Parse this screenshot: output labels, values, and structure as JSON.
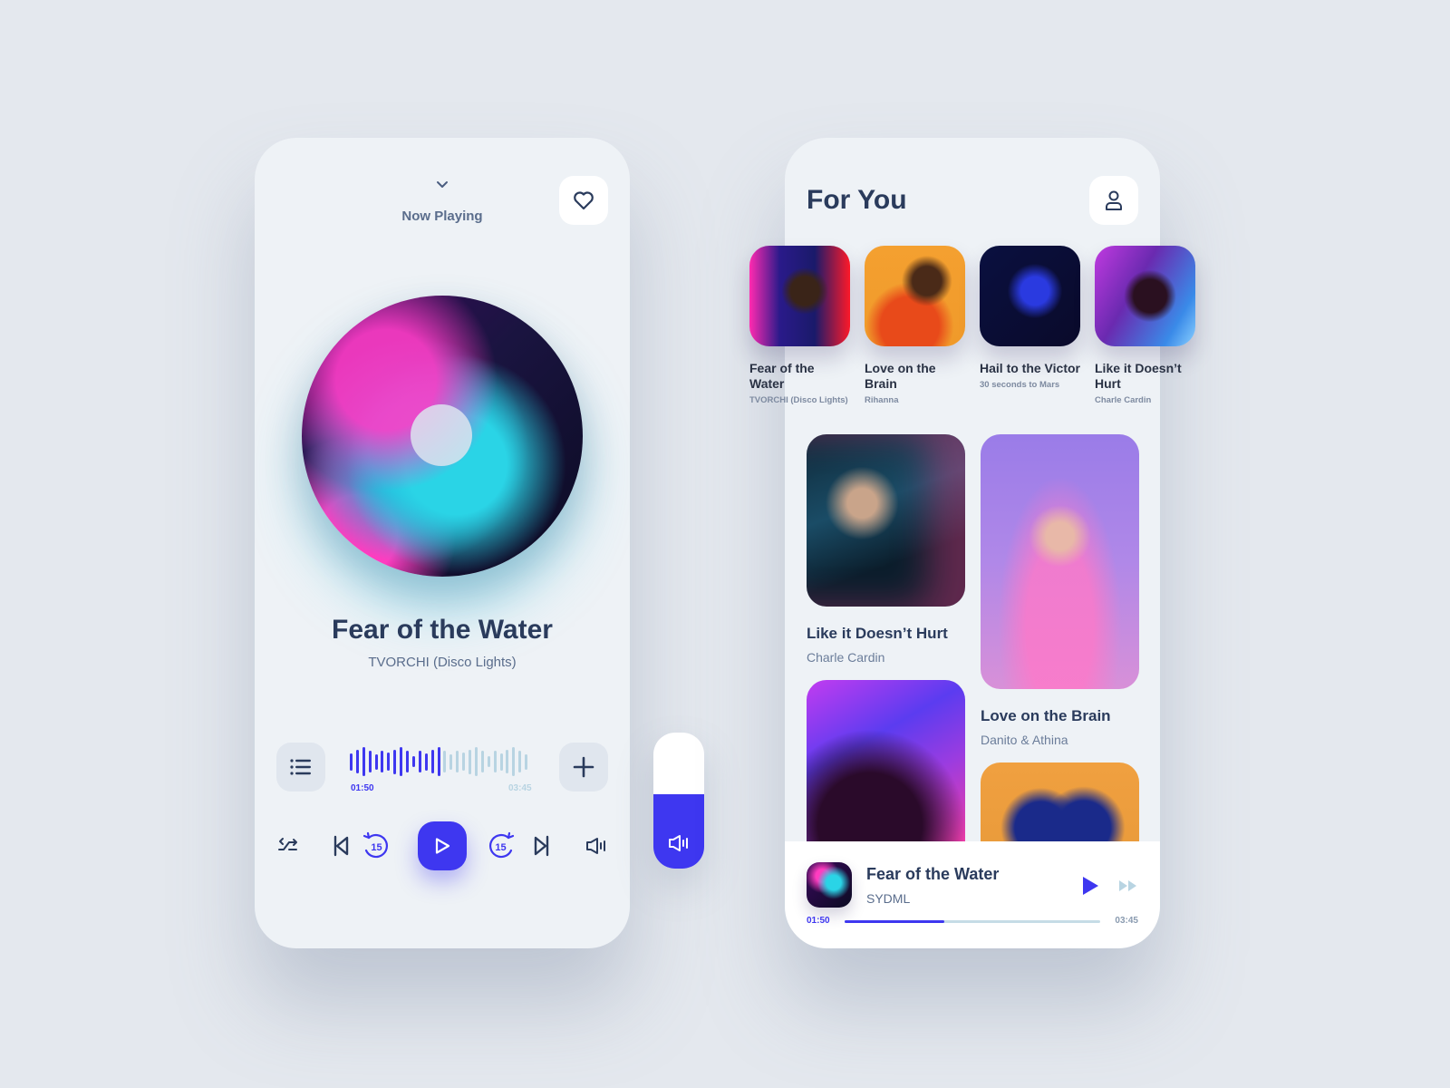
{
  "now_playing": {
    "header_title": "Now Playing",
    "song_title": "Fear of the Water",
    "artist": "TVORCHI (Disco Lights)",
    "current_time": "01:50",
    "total_time": "03:45",
    "progress": 0.49,
    "waveform_levels": [
      0.55,
      0.75,
      0.95,
      0.7,
      0.5,
      0.7,
      0.6,
      0.8,
      0.95,
      0.7,
      0.35,
      0.7,
      0.55,
      0.75,
      0.95,
      0.7,
      0.5,
      0.7,
      0.6,
      0.8,
      0.95,
      0.7,
      0.35,
      0.7,
      0.55,
      0.75,
      0.95,
      0.7,
      0.5
    ],
    "skip_back_seconds": "15",
    "skip_forward_seconds": "15",
    "icons": {
      "collapse": "chevron-down-icon",
      "favorite": "heart-icon",
      "playlist": "list-icon",
      "add": "plus-icon",
      "shuffle": "shuffle-icon",
      "previous": "skip-previous-icon",
      "rewind": "rewind-15-icon",
      "play": "play-icon",
      "forward": "forward-15-icon",
      "next": "skip-next-icon",
      "volume": "volume-icon"
    }
  },
  "volume": {
    "level": 0.55
  },
  "for_you": {
    "title": "For You",
    "featured": [
      {
        "title": "Fear of the Water",
        "artist": "TVORCHI (Disco Lights)"
      },
      {
        "title": "Love on the Brain",
        "artist": "Rihanna"
      },
      {
        "title": "Hail to the Victor",
        "artist": "30 seconds to Mars"
      },
      {
        "title": "Like it Doesn’t Hurt",
        "artist": "Charle Cardin"
      }
    ],
    "grid": [
      {
        "title": "Like it Doesn’t Hurt",
        "artist": "Charle Cardin"
      },
      {
        "title": "Love on the Brain",
        "artist": "Danito & Athina"
      }
    ],
    "mini_player": {
      "title": "Fear of the Water",
      "artist": "SYDML",
      "current_time": "01:50",
      "total_time": "03:45",
      "progress": 0.39
    }
  },
  "colors": {
    "accent": "#3e37f0",
    "text_dark": "#2a3b5c",
    "text_muted": "#5a6d8c",
    "wave_inactive": "#b8d4e2",
    "background": "#e4e8ee"
  }
}
